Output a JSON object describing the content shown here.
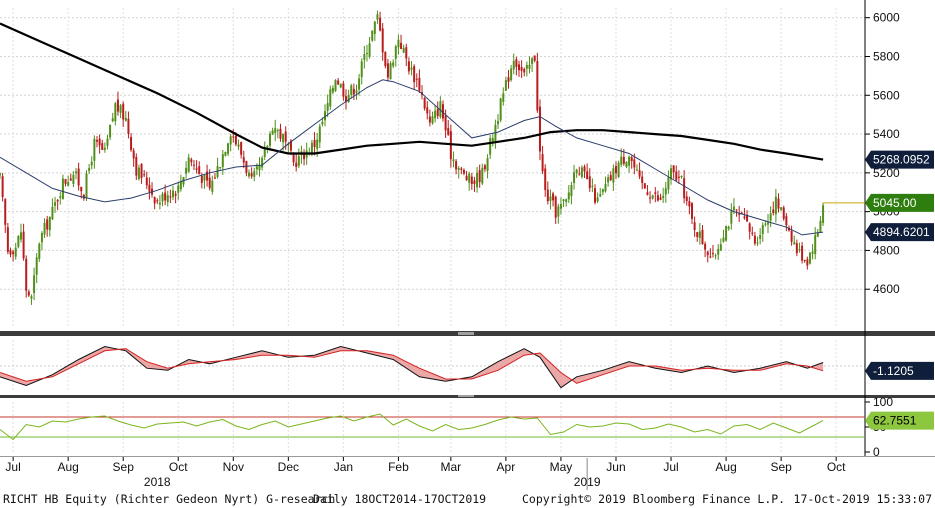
{
  "chart_data": {
    "type": "line",
    "series_desc": "Daily candlestick price with two moving averages, a MACD-style oscillator panel and an RSI-style panel",
    "price": {
      "ylim": [
        4400,
        6050
      ],
      "y_ticks": [
        "6000",
        "5800",
        "5600",
        "5400",
        "5200",
        "5000",
        "4800",
        "4600"
      ],
      "tick_values": [
        6000,
        5800,
        5600,
        5400,
        5200,
        5000,
        4800,
        4600
      ],
      "last_price": 5045.0,
      "last_price_label": "5045.00",
      "ma_long_label": "5268.0952",
      "ma_long_value": 5268.0952,
      "ma_short_label": "4894.6201",
      "ma_short_value": 4894.6201,
      "close_path": [
        [
          0,
          5170
        ],
        [
          3,
          4800
        ],
        [
          6,
          4820
        ],
        [
          8,
          4900
        ],
        [
          10,
          4600
        ],
        [
          12,
          4550
        ],
        [
          15,
          4850
        ],
        [
          20,
          5000
        ],
        [
          24,
          5150
        ],
        [
          28,
          5200
        ],
        [
          32,
          5100
        ],
        [
          36,
          5350
        ],
        [
          40,
          5300
        ],
        [
          44,
          5550
        ],
        [
          48,
          5480
        ],
        [
          52,
          5220
        ],
        [
          56,
          5150
        ],
        [
          60,
          5050
        ],
        [
          64,
          5100
        ],
        [
          68,
          5120
        ],
        [
          72,
          5280
        ],
        [
          76,
          5200
        ],
        [
          80,
          5120
        ],
        [
          84,
          5260
        ],
        [
          88,
          5420
        ],
        [
          92,
          5300
        ],
        [
          96,
          5150
        ],
        [
          100,
          5250
        ],
        [
          104,
          5450
        ],
        [
          108,
          5380
        ],
        [
          112,
          5250
        ],
        [
          116,
          5300
        ],
        [
          120,
          5350
        ],
        [
          124,
          5500
        ],
        [
          128,
          5700
        ],
        [
          132,
          5600
        ],
        [
          136,
          5650
        ],
        [
          140,
          5850
        ],
        [
          144,
          6000
        ],
        [
          148,
          5700
        ],
        [
          152,
          5900
        ],
        [
          156,
          5750
        ],
        [
          160,
          5650
        ],
        [
          164,
          5450
        ],
        [
          168,
          5550
        ],
        [
          172,
          5300
        ],
        [
          176,
          5200
        ],
        [
          180,
          5150
        ],
        [
          184,
          5200
        ],
        [
          188,
          5400
        ],
        [
          192,
          5600
        ],
        [
          196,
          5800
        ],
        [
          200,
          5700
        ],
        [
          204,
          5800
        ],
        [
          206,
          5300
        ],
        [
          208,
          5100
        ],
        [
          212,
          5000
        ],
        [
          216,
          5050
        ],
        [
          220,
          5250
        ],
        [
          224,
          5150
        ],
        [
          228,
          5050
        ],
        [
          232,
          5150
        ],
        [
          236,
          5250
        ],
        [
          240,
          5300
        ],
        [
          244,
          5150
        ],
        [
          248,
          5100
        ],
        [
          252,
          5050
        ],
        [
          256,
          5200
        ],
        [
          260,
          5150
        ],
        [
          264,
          4950
        ],
        [
          268,
          4850
        ],
        [
          272,
          4750
        ],
        [
          276,
          4900
        ],
        [
          280,
          5000
        ],
        [
          284,
          4950
        ],
        [
          288,
          4850
        ],
        [
          292,
          4950
        ],
        [
          296,
          5050
        ],
        [
          300,
          4950
        ],
        [
          304,
          4800
        ],
        [
          308,
          4750
        ],
        [
          312,
          4900
        ],
        [
          314,
          5045
        ]
      ],
      "ma_short_path": [
        [
          0,
          5280
        ],
        [
          10,
          5200
        ],
        [
          20,
          5120
        ],
        [
          30,
          5080
        ],
        [
          40,
          5050
        ],
        [
          50,
          5070
        ],
        [
          60,
          5110
        ],
        [
          70,
          5160
        ],
        [
          80,
          5200
        ],
        [
          90,
          5230
        ],
        [
          100,
          5240
        ],
        [
          110,
          5350
        ],
        [
          120,
          5450
        ],
        [
          130,
          5550
        ],
        [
          140,
          5640
        ],
        [
          146,
          5680
        ],
        [
          150,
          5670
        ],
        [
          160,
          5620
        ],
        [
          170,
          5500
        ],
        [
          180,
          5380
        ],
        [
          190,
          5410
        ],
        [
          200,
          5470
        ],
        [
          206,
          5490
        ],
        [
          212,
          5440
        ],
        [
          220,
          5380
        ],
        [
          230,
          5340
        ],
        [
          240,
          5300
        ],
        [
          250,
          5220
        ],
        [
          260,
          5140
        ],
        [
          270,
          5060
        ],
        [
          280,
          5000
        ],
        [
          290,
          4960
        ],
        [
          300,
          4920
        ],
        [
          306,
          4880
        ],
        [
          314,
          4894.6
        ]
      ],
      "ma_long_path": [
        [
          0,
          5970
        ],
        [
          15,
          5880
        ],
        [
          30,
          5790
        ],
        [
          45,
          5700
        ],
        [
          60,
          5610
        ],
        [
          75,
          5510
        ],
        [
          90,
          5400
        ],
        [
          100,
          5330
        ],
        [
          110,
          5300
        ],
        [
          120,
          5300
        ],
        [
          130,
          5320
        ],
        [
          140,
          5340
        ],
        [
          150,
          5350
        ],
        [
          160,
          5360
        ],
        [
          170,
          5350
        ],
        [
          180,
          5340
        ],
        [
          190,
          5360
        ],
        [
          200,
          5380
        ],
        [
          210,
          5410
        ],
        [
          220,
          5420
        ],
        [
          230,
          5420
        ],
        [
          240,
          5410
        ],
        [
          250,
          5400
        ],
        [
          260,
          5390
        ],
        [
          270,
          5370
        ],
        [
          280,
          5350
        ],
        [
          290,
          5320
        ],
        [
          300,
          5300
        ],
        [
          314,
          5268.1
        ]
      ]
    },
    "oscillator": {
      "ylim": [
        -6,
        6
      ],
      "last_label": "-1.1205",
      "last_value": -1.1205,
      "main_path": [
        [
          0,
          -2.5
        ],
        [
          10,
          -4.5
        ],
        [
          20,
          -2
        ],
        [
          30,
          1.5
        ],
        [
          40,
          4.5
        ],
        [
          48,
          3.5
        ],
        [
          56,
          -0.5
        ],
        [
          64,
          -1
        ],
        [
          72,
          1.5
        ],
        [
          80,
          0.5
        ],
        [
          90,
          2
        ],
        [
          100,
          3.5
        ],
        [
          110,
          2
        ],
        [
          120,
          2.5
        ],
        [
          130,
          4.5
        ],
        [
          140,
          3
        ],
        [
          150,
          1.5
        ],
        [
          160,
          -2.5
        ],
        [
          170,
          -3.5
        ],
        [
          180,
          -2.5
        ],
        [
          190,
          1
        ],
        [
          200,
          4
        ],
        [
          206,
          2
        ],
        [
          214,
          -5
        ],
        [
          220,
          -2.5
        ],
        [
          230,
          -1
        ],
        [
          240,
          1
        ],
        [
          250,
          -0.5
        ],
        [
          260,
          -1.5
        ],
        [
          270,
          0
        ],
        [
          280,
          -1.5
        ],
        [
          290,
          -0.5
        ],
        [
          300,
          1
        ],
        [
          308,
          -0.5
        ],
        [
          314,
          0.8
        ]
      ],
      "signal_path": [
        [
          0,
          -1.5
        ],
        [
          10,
          -3.5
        ],
        [
          20,
          -2.5
        ],
        [
          30,
          0.5
        ],
        [
          40,
          3.5
        ],
        [
          48,
          4
        ],
        [
          56,
          1
        ],
        [
          64,
          -0.5
        ],
        [
          72,
          0.5
        ],
        [
          80,
          1
        ],
        [
          90,
          1.5
        ],
        [
          100,
          2.5
        ],
        [
          110,
          2.5
        ],
        [
          120,
          2
        ],
        [
          130,
          3.5
        ],
        [
          140,
          3.5
        ],
        [
          150,
          2.5
        ],
        [
          160,
          -0.5
        ],
        [
          170,
          -3
        ],
        [
          180,
          -3
        ],
        [
          190,
          -1
        ],
        [
          200,
          2.5
        ],
        [
          206,
          3
        ],
        [
          214,
          -1.5
        ],
        [
          220,
          -4
        ],
        [
          230,
          -2
        ],
        [
          240,
          0
        ],
        [
          250,
          0
        ],
        [
          260,
          -1
        ],
        [
          270,
          -0.5
        ],
        [
          280,
          -1
        ],
        [
          290,
          -1
        ],
        [
          300,
          0.5
        ],
        [
          308,
          0
        ],
        [
          314,
          -1.1
        ]
      ]
    },
    "rsi": {
      "ylim": [
        0,
        100
      ],
      "y_ticks": [
        "100",
        "50",
        "0"
      ],
      "tick_values": [
        100,
        50,
        0
      ],
      "upper_band": 70,
      "lower_band": 30,
      "last_label": "62.7551",
      "last_value": 62.7551,
      "path": [
        [
          0,
          45
        ],
        [
          5,
          25
        ],
        [
          10,
          55
        ],
        [
          15,
          50
        ],
        [
          20,
          62
        ],
        [
          25,
          60
        ],
        [
          30,
          66
        ],
        [
          35,
          70
        ],
        [
          40,
          72
        ],
        [
          45,
          62
        ],
        [
          50,
          54
        ],
        [
          55,
          48
        ],
        [
          60,
          56
        ],
        [
          65,
          58
        ],
        [
          70,
          60
        ],
        [
          75,
          52
        ],
        [
          80,
          60
        ],
        [
          85,
          65
        ],
        [
          90,
          52
        ],
        [
          95,
          45
        ],
        [
          100,
          55
        ],
        [
          105,
          62
        ],
        [
          110,
          50
        ],
        [
          115,
          56
        ],
        [
          120,
          62
        ],
        [
          125,
          68
        ],
        [
          130,
          72
        ],
        [
          135,
          62
        ],
        [
          140,
          70
        ],
        [
          145,
          76
        ],
        [
          150,
          54
        ],
        [
          155,
          66
        ],
        [
          160,
          52
        ],
        [
          165,
          42
        ],
        [
          170,
          55
        ],
        [
          175,
          45
        ],
        [
          180,
          48
        ],
        [
          185,
          55
        ],
        [
          190,
          64
        ],
        [
          195,
          70
        ],
        [
          200,
          66
        ],
        [
          205,
          68
        ],
        [
          210,
          35
        ],
        [
          215,
          40
        ],
        [
          220,
          55
        ],
        [
          225,
          50
        ],
        [
          230,
          52
        ],
        [
          235,
          58
        ],
        [
          240,
          56
        ],
        [
          245,
          45
        ],
        [
          250,
          48
        ],
        [
          255,
          56
        ],
        [
          260,
          50
        ],
        [
          265,
          40
        ],
        [
          270,
          45
        ],
        [
          275,
          36
        ],
        [
          280,
          52
        ],
        [
          285,
          55
        ],
        [
          290,
          45
        ],
        [
          295,
          58
        ],
        [
          300,
          48
        ],
        [
          305,
          38
        ],
        [
          310,
          52
        ],
        [
          314,
          62.8
        ]
      ]
    },
    "x_ticks": [
      {
        "label": "Jul",
        "pos": 5
      },
      {
        "label": "Aug",
        "pos": 26
      },
      {
        "label": "Sep",
        "pos": 47
      },
      {
        "label": "Oct",
        "pos": 68
      },
      {
        "label": "Nov",
        "pos": 89
      },
      {
        "label": "Dec",
        "pos": 110
      },
      {
        "label": "Jan",
        "pos": 131
      },
      {
        "label": "Feb",
        "pos": 152
      },
      {
        "label": "Mar",
        "pos": 172
      },
      {
        "label": "Apr",
        "pos": 193
      },
      {
        "label": "May",
        "pos": 214
      },
      {
        "label": "Jun",
        "pos": 235
      },
      {
        "label": "Jul",
        "pos": 256
      },
      {
        "label": "Aug",
        "pos": 277
      },
      {
        "label": "Sep",
        "pos": 298
      },
      {
        "label": "Oct",
        "pos": 319
      }
    ],
    "x_range": [
      0,
      330
    ],
    "year_labels": [
      {
        "label": "2018",
        "pos": 60
      },
      {
        "label": "2019",
        "pos": 224
      }
    ]
  },
  "footer": {
    "security": "RICHT HB Equity (Richter Gedeon Nyrt) G-research",
    "period": "Daily 18OCT2014-17OCT2019",
    "copyright": "Copyright© 2019 Bloomberg Finance L.P.",
    "timestamp": "17-Oct-2019 15:33:07"
  },
  "colors": {
    "up": "#4f8f1a",
    "down": "#b81c1c",
    "ma_short": "#2b3d6b",
    "ma_long": "#000000",
    "rsi": "#7ab51d",
    "rsi_upper": "#c0392b",
    "rsi_lower": "#6dbe2e",
    "osc_fill": "#e58a8a",
    "osc_signal": "#d22222",
    "tag_price": "#2e7d0f",
    "tag_dark": "#0f1e3a",
    "panel_sep": "#3c3c3c"
  }
}
